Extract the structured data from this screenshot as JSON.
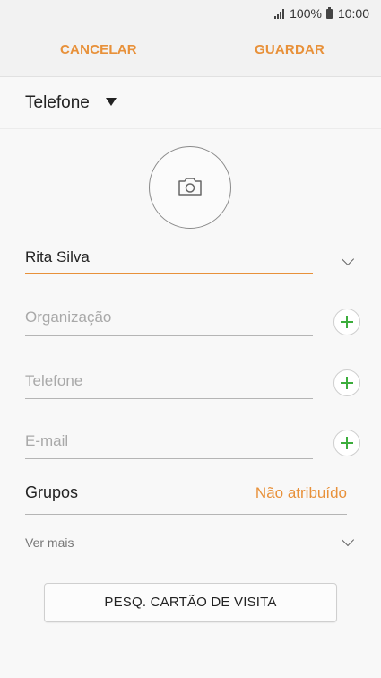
{
  "status": {
    "battery_text": "100%",
    "time": "10:00"
  },
  "actions": {
    "cancel": "CANCELAR",
    "save": "GUARDAR"
  },
  "account": {
    "label": "Telefone"
  },
  "fields": {
    "name_value": "Rita Silva",
    "organization_placeholder": "Organização",
    "phone_placeholder": "Telefone",
    "email_placeholder": "E-mail"
  },
  "groups": {
    "label": "Grupos",
    "value": "Não atribuído"
  },
  "more": {
    "label": "Ver mais"
  },
  "card_button": {
    "label": "PESQ. CARTÃO DE VISITA"
  },
  "colors": {
    "accent": "#e8913a",
    "add": "#3cad3c"
  }
}
